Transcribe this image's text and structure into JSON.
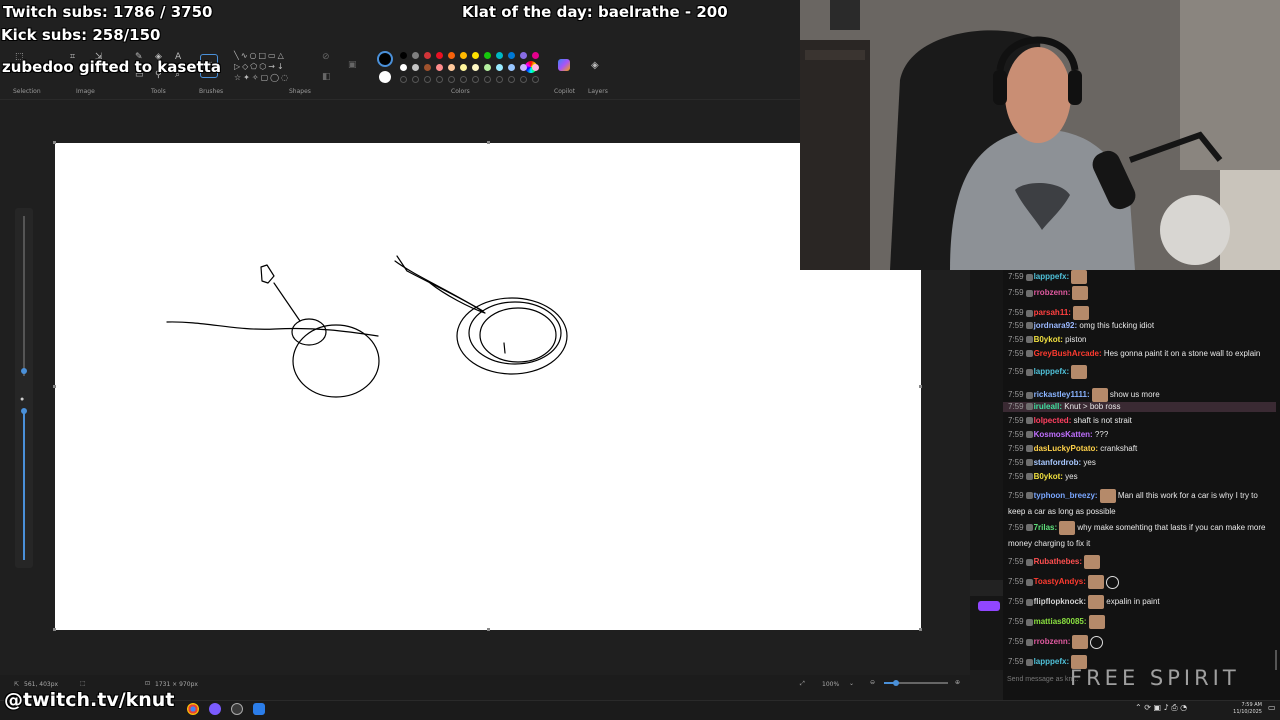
{
  "overlay": {
    "twitch_subs": "Twitch subs: 1786 / 3750",
    "kick_subs": "Kick subs: 258/150",
    "gift": "zubedoo gifted to kasetta",
    "klat": "Klat of the day: baelrathe - 200",
    "channel": "@twitch.tv/knut",
    "brand": "FREE SPIRIT"
  },
  "paint": {
    "groups": [
      "Selection",
      "Image",
      "Tools",
      "Brushes",
      "Shapes",
      "Colors",
      "Copilot",
      "Layers"
    ],
    "status": {
      "cursor": "561, 403px",
      "size": "1731 × 970px",
      "zoom": "100%"
    },
    "colors": [
      "#000000",
      "#7f7f7f",
      "#d13438",
      "#e81123",
      "#f7630c",
      "#ffb900",
      "#fce100",
      "#16c60c",
      "#00b7c3",
      "#0078d4",
      "#886ce4",
      "#e3008c"
    ],
    "colors2": [
      "#ffffff",
      "#c3c3c3",
      "#a0522d",
      "#ff8c8c",
      "#ffc99c",
      "#fff69c",
      "#fff9c4",
      "#b4f0a0",
      "#99ebff",
      "#99c6ff",
      "#c8b4ff",
      "#ffb4e4"
    ],
    "icons": [
      "selection-icon",
      "crop-icon",
      "pencil-icon",
      "fill-icon",
      "text-icon",
      "eraser-icon",
      "color-picker-icon",
      "magnifier-icon",
      "brush-icon",
      "copilot-icon",
      "layers-icon"
    ]
  },
  "chat": {
    "messages": [
      {
        "time": "7:59",
        "user": "lapppefx:",
        "color": "#4fc1d9",
        "text": "",
        "emote": true
      },
      {
        "time": "7:59",
        "user": "rrobzenn:",
        "color": "#e05aa0",
        "text": "",
        "emote": true
      },
      {
        "time": "7:59",
        "user": "parsah11:",
        "color": "#ff4040",
        "text": "",
        "emote": true
      },
      {
        "time": "7:59",
        "user": "jordnara92:",
        "color": "#9ab8ff",
        "text": "omg this fucking idiot",
        "emote": false
      },
      {
        "time": "7:59",
        "user": "B0ykot:",
        "color": "#f0e040",
        "text": "piston",
        "emote": false
      },
      {
        "time": "7:59",
        "user": "GreyBushArcade:",
        "color": "#ff3b30",
        "text": "Hes gonna paint it on a stone wall to explain",
        "emote": false
      },
      {
        "time": "7:59",
        "user": "lapppefx:",
        "color": "#4fc1d9",
        "text": "",
        "emote": true
      },
      {
        "time": "7:59",
        "user": "rickastley1111:",
        "color": "#8ab4ff",
        "text": "show us more",
        "emote": true
      },
      {
        "time": "7:59",
        "user": "iruleall:",
        "color": "#40e0a0",
        "text": "Knut > bob ross",
        "emote": false
      },
      {
        "time": "7:59",
        "user": "lolpected:",
        "color": "#ff4060",
        "text": "shaft is not strait",
        "emote": false
      },
      {
        "time": "7:59",
        "user": "KosmosKatten:",
        "color": "#c070ff",
        "text": "???",
        "emote": false
      },
      {
        "time": "7:59",
        "user": "dasLuckyPotato:",
        "color": "#ffd24a",
        "text": "crankshaft",
        "emote": false
      },
      {
        "time": "7:59",
        "user": "stanfordrob:",
        "color": "#a8c8ff",
        "text": "yes",
        "emote": false
      },
      {
        "time": "7:59",
        "user": "B0ykot:",
        "color": "#f0e040",
        "text": "yes",
        "emote": false
      },
      {
        "time": "7:59",
        "user": "typhoon_breezy:",
        "color": "#7aa7ff",
        "text": "Man all this work for a car is why I try to keep a car as long as possible",
        "emote": true
      },
      {
        "time": "7:59",
        "user": "7rilas:",
        "color": "#5ee07a",
        "text": "why make somehting that lasts if you can make more money charging to fix it",
        "emote": true
      },
      {
        "time": "7:59",
        "user": "Rubathebes:",
        "color": "#ff5050",
        "text": "",
        "emote": true
      },
      {
        "time": "7:59",
        "user": "ToastyAndys:",
        "color": "#ff3b30",
        "text": "",
        "emote": true
      },
      {
        "time": "7:59",
        "user": "flipflopknock:",
        "color": "#d0d0d0",
        "text": "expalin in paint",
        "emote": true
      },
      {
        "time": "7:59",
        "user": "mattias80085:",
        "color": "#8ae040",
        "text": "",
        "emote": true
      },
      {
        "time": "7:59",
        "user": "rrobzenn:",
        "color": "#e05aa0",
        "text": "",
        "emote": true
      },
      {
        "time": "7:59",
        "user": "lapppefx:",
        "color": "#4fc1d9",
        "text": "",
        "emote": true
      }
    ],
    "input_placeholder": "Send message as kn..."
  },
  "tray": {
    "time": "7:59 AM",
    "date": "11/10/2025"
  }
}
